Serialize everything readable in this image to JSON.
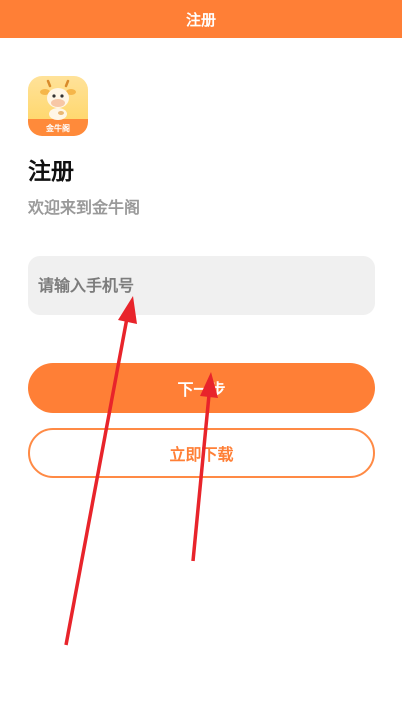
{
  "header": {
    "title": "注册"
  },
  "logo": {
    "label": "金牛阁",
    "icon": "cow-mascot-icon"
  },
  "page": {
    "title": "注册",
    "subtitle": "欢迎来到金牛阁"
  },
  "form": {
    "phone_placeholder": "请输入手机号",
    "phone_value": ""
  },
  "buttons": {
    "next_label": "下一步",
    "download_label": "立即下载"
  },
  "colors": {
    "accent": "#ff7f36",
    "annotation_arrow": "#e8242b",
    "input_bg": "#f0f0f0"
  }
}
